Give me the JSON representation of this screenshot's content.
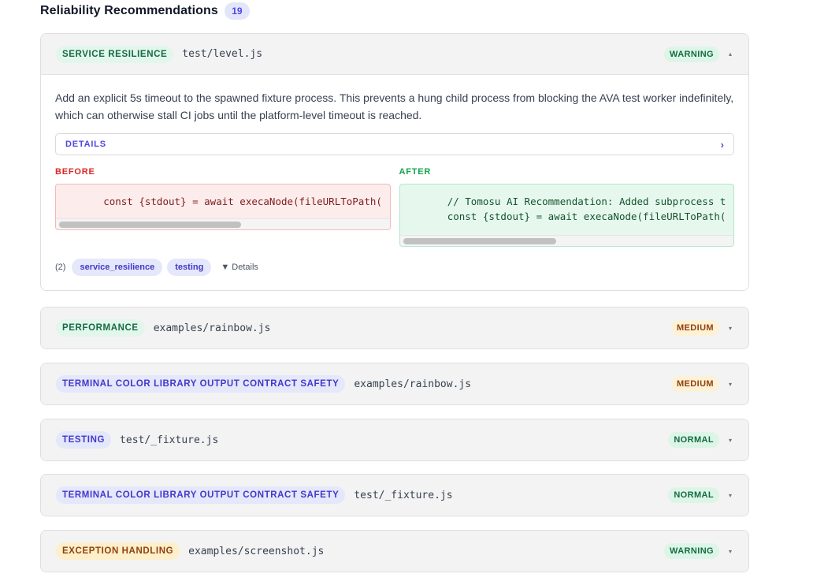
{
  "header": {
    "title": "Reliability Recommendations",
    "count": "19"
  },
  "cards": [
    {
      "category": "SERVICE RESILIENCE",
      "file": "test/level.js",
      "severity": "WARNING",
      "caret": "▴",
      "description": "Add an explicit 5s timeout to the spawned fixture process. This prevents a hung child process from blocking the AVA test worker indefinitely, which can otherwise stall CI jobs until the platform-level timeout is reached.",
      "details_label": "DETAILS",
      "details_chevron": "›",
      "before_label": "BEFORE",
      "after_label": "AFTER",
      "before_code": "        const {stdout} = await execaNode(fileURLToPath(",
      "after_code": "        // Tomosu AI Recommendation: Added subprocess t\n        const {stdout} = await execaNode(fileURLToPath(",
      "tag_count": "(2)",
      "tags": [
        "service_resilience",
        "testing"
      ],
      "details_toggle": "▼ Details"
    },
    {
      "category": "PERFORMANCE",
      "file": "examples/rainbow.js",
      "severity": "MEDIUM",
      "caret": "▾"
    },
    {
      "category": "TERMINAL COLOR LIBRARY OUTPUT CONTRACT SAFETY",
      "file": "examples/rainbow.js",
      "severity": "MEDIUM",
      "caret": "▾"
    },
    {
      "category": "TESTING",
      "file": "test/_fixture.js",
      "severity": "NORMAL",
      "caret": "▾"
    },
    {
      "category": "TERMINAL COLOR LIBRARY OUTPUT CONTRACT SAFETY",
      "file": "test/_fixture.js",
      "severity": "NORMAL",
      "caret": "▾"
    },
    {
      "category": "EXCEPTION HANDLING",
      "file": "examples/screenshot.js",
      "severity": "WARNING",
      "caret": "▾"
    }
  ],
  "colors": {
    "accent": "#4f46e5",
    "before": "#dc2626",
    "after": "#16a34a",
    "warning_badge": "#146c43",
    "medium_badge": "#92400e"
  }
}
